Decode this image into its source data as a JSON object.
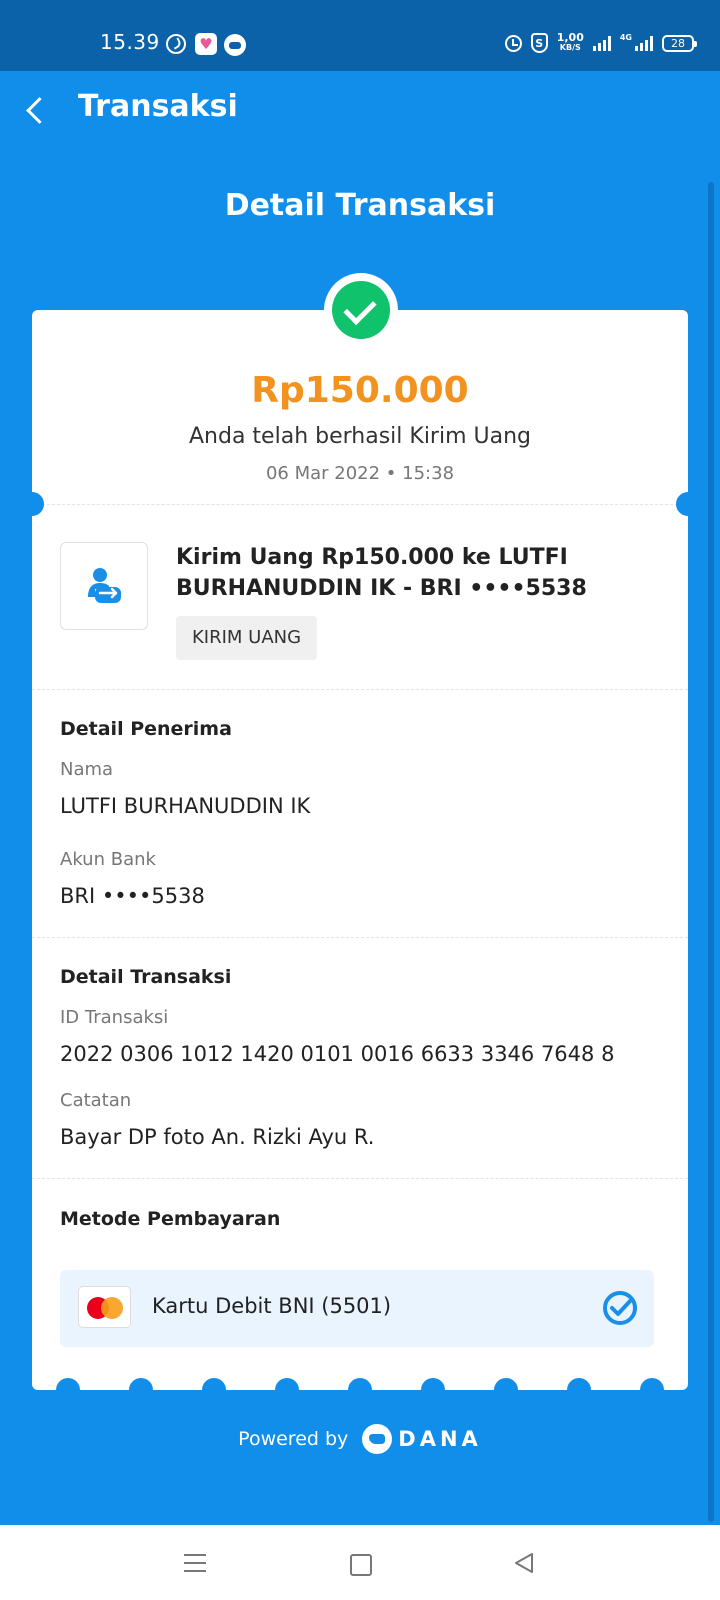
{
  "status_bar": {
    "time": "15.39",
    "speed_value": "1,00",
    "speed_unit": "KB/S",
    "network": "4G",
    "battery": "28"
  },
  "app_bar": {
    "title": "Transaksi"
  },
  "page_title": "Detail Transaksi",
  "summary": {
    "amount": "Rp150.000",
    "message": "Anda telah berhasil Kirim Uang",
    "datetime": "06 Mar 2022 • 15:38"
  },
  "transaction": {
    "description": "Kirim Uang Rp150.000 ke LUTFI BURHANUDDIN IK - BRI ••••5538",
    "tag": "KIRIM UANG",
    "icon": "send-money-icon"
  },
  "recipient": {
    "section_title": "Detail Penerima",
    "name_label": "Nama",
    "name_value": "LUTFI BURHANUDDIN IK",
    "bank_label": "Akun Bank",
    "bank_value": "BRI ••••5538"
  },
  "details": {
    "section_title": "Detail Transaksi",
    "id_label": "ID Transaksi",
    "id_value": "2022 0306 1012 1420 0101 0016 6633 3346 7648 8",
    "note_label": "Catatan",
    "note_value": "Bayar DP foto An. Rizki Ayu R."
  },
  "payment": {
    "section_title": "Metode Pembayaran",
    "method": "Kartu Debit BNI (5501)",
    "card_icon": "mastercard-icon"
  },
  "footer": {
    "powered_by": "Powered by",
    "brand": "DANA"
  },
  "colors": {
    "primary": "#118EEA",
    "status_bar": "#0B62A8",
    "amount": "#F2921F",
    "success": "#11C26D"
  }
}
